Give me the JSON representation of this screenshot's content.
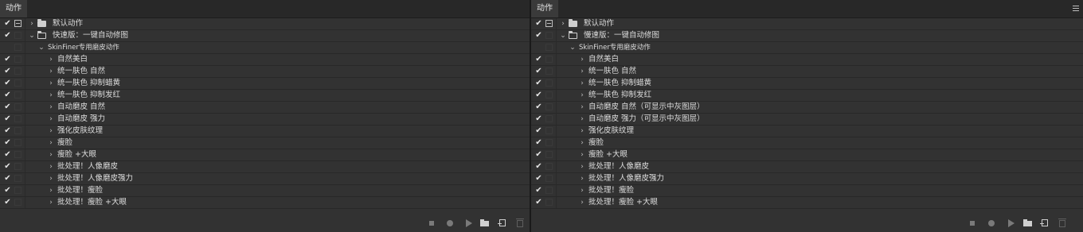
{
  "left_panel": {
    "tab": "动作",
    "rows": [
      {
        "check": "✔",
        "dialog": true,
        "indent": 0,
        "chevron": "›",
        "folder": "closed",
        "label": "默认动作"
      },
      {
        "check": "✔",
        "dialog": false,
        "indent": 0,
        "chevron": "⌄",
        "folder": "open",
        "label": "快速版：一键自动修图"
      },
      {
        "check": "",
        "dialog": false,
        "indent": 1,
        "chevron": "⌄",
        "folder": "",
        "label": "SkinFiner专用磨皮动作"
      },
      {
        "check": "✔",
        "dialog": false,
        "indent": 2,
        "chevron": "›",
        "folder": "",
        "label": "自然美白"
      },
      {
        "check": "✔",
        "dialog": false,
        "indent": 2,
        "chevron": "›",
        "folder": "",
        "label": "统一肤色 自然"
      },
      {
        "check": "✔",
        "dialog": false,
        "indent": 2,
        "chevron": "›",
        "folder": "",
        "label": "统一肤色 抑制蜡黄"
      },
      {
        "check": "✔",
        "dialog": false,
        "indent": 2,
        "chevron": "›",
        "folder": "",
        "label": "统一肤色 抑制发红"
      },
      {
        "check": "✔",
        "dialog": false,
        "indent": 2,
        "chevron": "›",
        "folder": "",
        "label": "自动磨皮  自然"
      },
      {
        "check": "✔",
        "dialog": false,
        "indent": 2,
        "chevron": "›",
        "folder": "",
        "label": "自动磨皮  强力"
      },
      {
        "check": "✔",
        "dialog": false,
        "indent": 2,
        "chevron": "›",
        "folder": "",
        "label": "强化皮肤纹理"
      },
      {
        "check": "✔",
        "dialog": false,
        "indent": 2,
        "chevron": "›",
        "folder": "",
        "label": "瘦脸"
      },
      {
        "check": "✔",
        "dialog": false,
        "indent": 2,
        "chevron": "›",
        "folder": "",
        "label": "瘦脸 +大眼"
      },
      {
        "check": "✔",
        "dialog": false,
        "indent": 2,
        "chevron": "›",
        "folder": "",
        "label": "批处理！人像磨皮"
      },
      {
        "check": "✔",
        "dialog": false,
        "indent": 2,
        "chevron": "›",
        "folder": "",
        "label": "批处理！人像磨皮强力"
      },
      {
        "check": "✔",
        "dialog": false,
        "indent": 2,
        "chevron": "›",
        "folder": "",
        "label": "批处理！瘦脸"
      },
      {
        "check": "✔",
        "dialog": false,
        "indent": 2,
        "chevron": "›",
        "folder": "",
        "label": "批处理！瘦脸 +大眼"
      }
    ]
  },
  "right_panel": {
    "tab": "动作",
    "rows": [
      {
        "check": "✔",
        "dialog": true,
        "indent": 0,
        "chevron": "›",
        "folder": "closed",
        "label": "默认动作"
      },
      {
        "check": "✔",
        "dialog": false,
        "indent": 0,
        "chevron": "⌄",
        "folder": "open",
        "label": "慢速版：一键自动修图"
      },
      {
        "check": "",
        "dialog": false,
        "indent": 1,
        "chevron": "⌄",
        "folder": "",
        "label": "SkinFiner专用磨皮动作"
      },
      {
        "check": "✔",
        "dialog": false,
        "indent": 2,
        "chevron": "›",
        "folder": "",
        "label": "自然美白"
      },
      {
        "check": "✔",
        "dialog": false,
        "indent": 2,
        "chevron": "›",
        "folder": "",
        "label": "统一肤色 自然"
      },
      {
        "check": "✔",
        "dialog": false,
        "indent": 2,
        "chevron": "›",
        "folder": "",
        "label": "统一肤色 抑制蜡黄"
      },
      {
        "check": "✔",
        "dialog": false,
        "indent": 2,
        "chevron": "›",
        "folder": "",
        "label": "统一肤色 抑制发红"
      },
      {
        "check": "✔",
        "dialog": false,
        "indent": 2,
        "chevron": "›",
        "folder": "",
        "label": "自动磨皮  自然（可显示中灰图层）"
      },
      {
        "check": "✔",
        "dialog": false,
        "indent": 2,
        "chevron": "›",
        "folder": "",
        "label": "自动磨皮  强力（可显示中灰图层）"
      },
      {
        "check": "✔",
        "dialog": false,
        "indent": 2,
        "chevron": "›",
        "folder": "",
        "label": "强化皮肤纹理"
      },
      {
        "check": "✔",
        "dialog": false,
        "indent": 2,
        "chevron": "›",
        "folder": "",
        "label": "瘦脸"
      },
      {
        "check": "✔",
        "dialog": false,
        "indent": 2,
        "chevron": "›",
        "folder": "",
        "label": "瘦脸 +大眼"
      },
      {
        "check": "✔",
        "dialog": false,
        "indent": 2,
        "chevron": "›",
        "folder": "",
        "label": "批处理！人像磨皮"
      },
      {
        "check": "✔",
        "dialog": false,
        "indent": 2,
        "chevron": "›",
        "folder": "",
        "label": "批处理！人像磨皮强力"
      },
      {
        "check": "✔",
        "dialog": false,
        "indent": 2,
        "chevron": "›",
        "folder": "",
        "label": "批处理！瘦脸"
      },
      {
        "check": "✔",
        "dialog": false,
        "indent": 2,
        "chevron": "›",
        "folder": "",
        "label": "批处理！瘦脸 +大眼"
      }
    ]
  },
  "bottom_icons": [
    "stop-icon",
    "record-icon",
    "play-icon",
    "new-set-folder-icon",
    "new-action-icon",
    "trash-icon"
  ],
  "colors": {
    "panel_bg": "#323232",
    "row_border": "#282828",
    "text": "#dcdcdc"
  }
}
